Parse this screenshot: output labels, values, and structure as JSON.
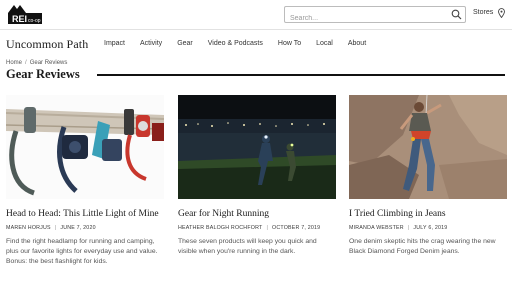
{
  "header": {
    "logo_text": "REI co-op",
    "search_placeholder": "Search...",
    "stores_label": "Stores"
  },
  "site": {
    "brand": "Uncommon Path",
    "nav": [
      "Impact",
      "Activity",
      "Gear",
      "Video & Podcasts",
      "How To",
      "Local",
      "About"
    ]
  },
  "breadcrumb": [
    "Home",
    "Gear Reviews"
  ],
  "section_title": "Gear Reviews",
  "icons": {
    "search": "search-icon",
    "stores": "map-pin-icon"
  },
  "articles": [
    {
      "title": "Head to Head: This Little Light of Mine",
      "author": "MAREN HORJUS",
      "date": "JUNE 7, 2020",
      "description": "Find the right headlamp for running and camping, plus our favorite lights for everyday use and value. Bonus: the best flashlight for kids."
    },
    {
      "title": "Gear for Night Running",
      "author": "HEATHER BALOGH ROCHFORT",
      "date": "OCTOBER 7, 2019",
      "description": "These seven products will keep you quick and visible when you're running in the dark."
    },
    {
      "title": "I Tried Climbing in Jeans",
      "author": "MIRANDA WEBSTER",
      "date": "JULY 6, 2019",
      "description": "One denim skeptic hits the crag wearing the new Black Diamond Forged Denim jeans."
    }
  ]
}
